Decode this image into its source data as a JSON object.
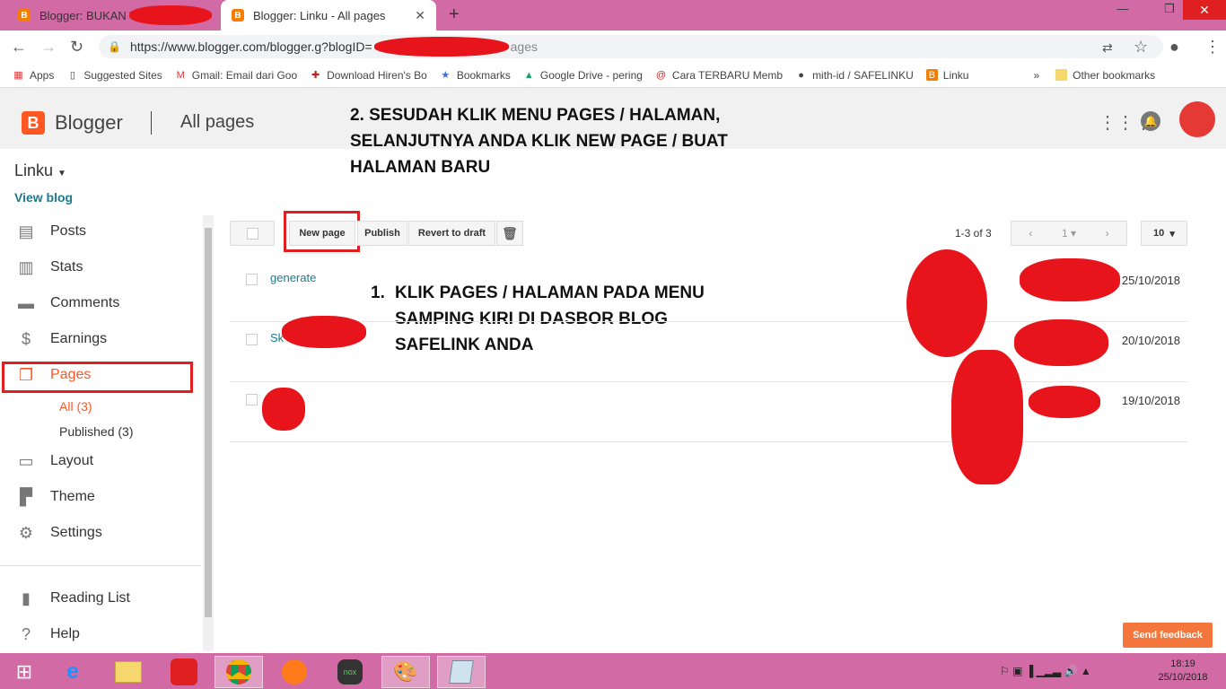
{
  "browser": {
    "tabs": [
      {
        "title": "Blogger: BUKAN TU"
      },
      {
        "title": "Blogger: Linku - All pages"
      }
    ],
    "new_tab": "+",
    "url": "https://www.blogger.com/blogger.g?blogID=",
    "url_tail": "ages",
    "bookmarks": [
      {
        "label": "Apps",
        "icon": "apps-grid-icon"
      },
      {
        "label": "Suggested Sites",
        "icon": "page-icon"
      },
      {
        "label": "Gmail: Email dari Goo",
        "icon": "gmail-icon"
      },
      {
        "label": "Download Hiren's Bo",
        "icon": "hirens-icon"
      },
      {
        "label": "Bookmarks",
        "icon": "star-icon"
      },
      {
        "label": "Google Drive - pering",
        "icon": "drive-icon"
      },
      {
        "label": "Cara TERBARU Memb",
        "icon": "site-icon"
      },
      {
        "label": "mith-id / SAFELINKU",
        "icon": "github-icon"
      },
      {
        "label": "Linku",
        "icon": "blogger-icon"
      }
    ],
    "more_bookmarks": "»",
    "other_bookmarks": "Other bookmarks"
  },
  "header": {
    "app_name": "Blogger",
    "page_title": "All pages"
  },
  "annotations": {
    "step2": "2. SESUDAH KLIK MENU PAGES / HALAMAN, SELANJUTNYA ANDA KLIK NEW PAGE / BUAT HALAMAN BARU",
    "step1_num": "1.",
    "step1": "KLIK PAGES / HALAMAN PADA MENU SAMPING KIRI DI DASBOR BLOG SAFELINK ANDA"
  },
  "sidebar": {
    "blog_name": "Linku",
    "view_blog": "View blog",
    "items": [
      {
        "label": "Posts",
        "icon": "posts-icon"
      },
      {
        "label": "Stats",
        "icon": "stats-icon"
      },
      {
        "label": "Comments",
        "icon": "comments-icon"
      },
      {
        "label": "Earnings",
        "icon": "dollar-icon"
      },
      {
        "label": "Pages",
        "icon": "pages-icon"
      },
      {
        "label": "Layout",
        "icon": "layout-icon"
      },
      {
        "label": "Theme",
        "icon": "theme-icon"
      },
      {
        "label": "Settings",
        "icon": "gear-icon"
      },
      {
        "label": "Reading List",
        "icon": "bookmark-icon"
      },
      {
        "label": "Help",
        "icon": "help-icon"
      }
    ],
    "sub_items": [
      {
        "label": "All (3)"
      },
      {
        "label": "Published (3)"
      }
    ]
  },
  "toolbar": {
    "new_page": "New page",
    "publish": "Publish",
    "revert": "Revert to draft",
    "page_count": "1-3 of 3",
    "current_page": "1",
    "per_page": "10"
  },
  "pages_list": [
    {
      "title": "generate",
      "date": "25/10/2018"
    },
    {
      "title": "Sk",
      "date": "20/10/2018"
    },
    {
      "title": "",
      "date": "19/10/2018"
    }
  ],
  "feedback": "Send feedback",
  "clock": {
    "time": "18:19",
    "date": "25/10/2018"
  },
  "colors": {
    "accent": "#ff5722",
    "link": "#1f7a8c",
    "highlight": "#e02020",
    "chrome": "#d26aa6"
  }
}
